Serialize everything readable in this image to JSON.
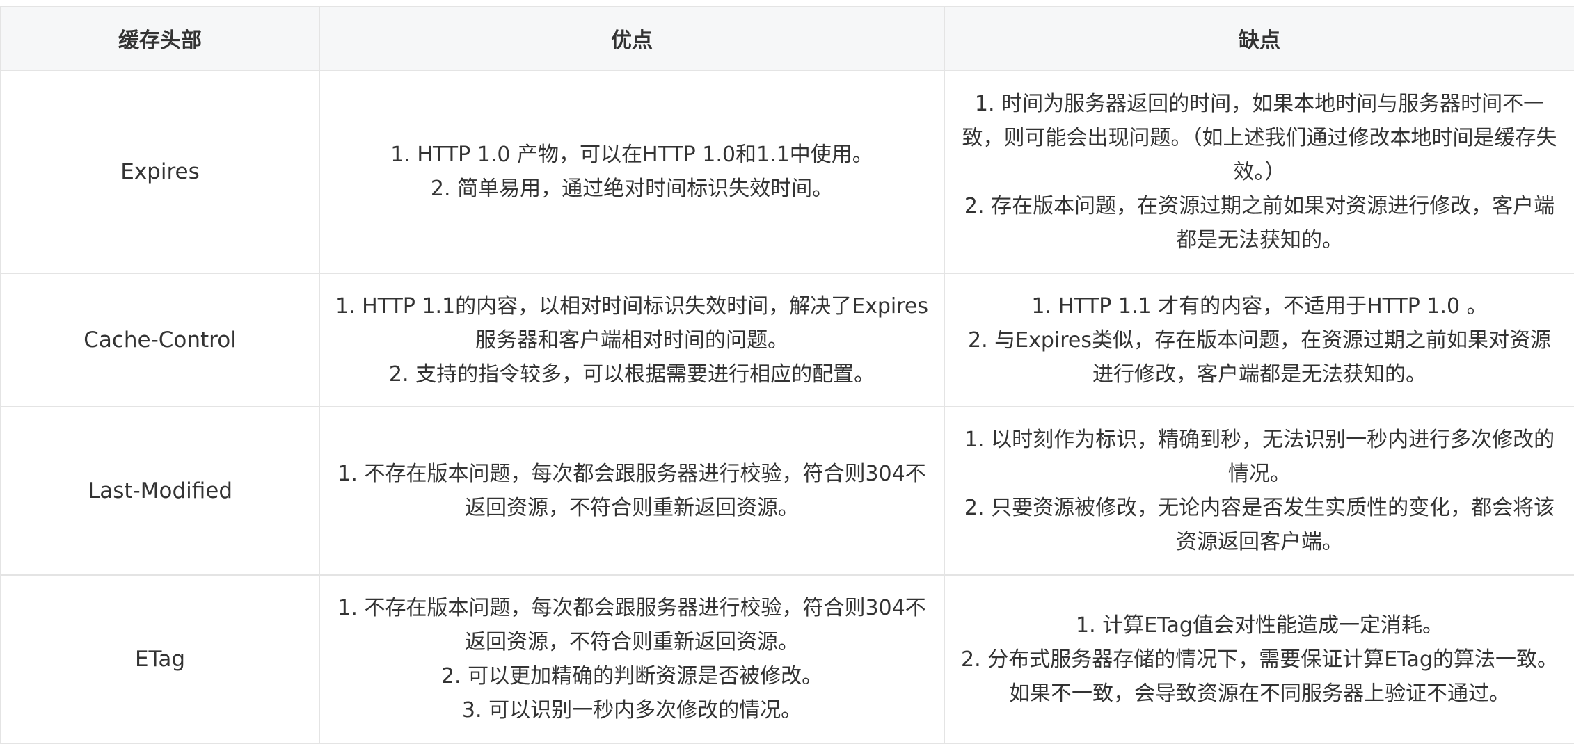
{
  "table": {
    "headers": [
      "缓存头部",
      "优点",
      "缺点"
    ],
    "rows": [
      {
        "name": "Expires",
        "pros": [
          "1. HTTP 1.0 产物，可以在HTTP 1.0和1.1中使用。",
          "2. 简单易用，通过绝对时间标识失效时间。"
        ],
        "cons": [
          "1. 时间为服务器返回的时间，如果本地时间与服务器时间不一致，则可能会出现问题。（如上述我们通过修改本地时间是缓存失效。）",
          "2. 存在版本问题，在资源过期之前如果对资源进行修改，客户端都是无法获知的。"
        ]
      },
      {
        "name": "Cache-Control",
        "pros": [
          "1. HTTP 1.1的内容，以相对时间标识失效时间，解决了Expires服务器和客户端相对时间的问题。",
          "2. 支持的指令较多，可以根据需要进行相应的配置。"
        ],
        "cons": [
          "1. HTTP 1.1 才有的内容，不适用于HTTP 1.0 。",
          "2. 与Expires类似，存在版本问题，在资源过期之前如果对资源进行修改，客户端都是无法获知的。"
        ]
      },
      {
        "name": "Last-Modified",
        "pros": [
          "1. 不存在版本问题，每次都会跟服务器进行校验，符合则304不返回资源，不符合则重新返回资源。"
        ],
        "cons": [
          "1. 以时刻作为标识，精确到秒，无法识别一秒内进行多次修改的情况。",
          "2. 只要资源被修改，无论内容是否发生实质性的变化，都会将该资源返回客户端。"
        ]
      },
      {
        "name": "ETag",
        "pros": [
          "1. 不存在版本问题，每次都会跟服务器进行校验，符合则304不返回资源，不符合则重新返回资源。",
          "2. 可以更加精确的判断资源是否被修改。",
          "3. 可以识别一秒内多次修改的情况。"
        ],
        "cons": [
          "1. 计算ETag值会对性能造成一定消耗。",
          "2. 分布式服务器存储的情况下，需要保证计算ETag的算法一致。如果不一致，会导致资源在不同服务器上验证不通过。"
        ]
      }
    ]
  }
}
